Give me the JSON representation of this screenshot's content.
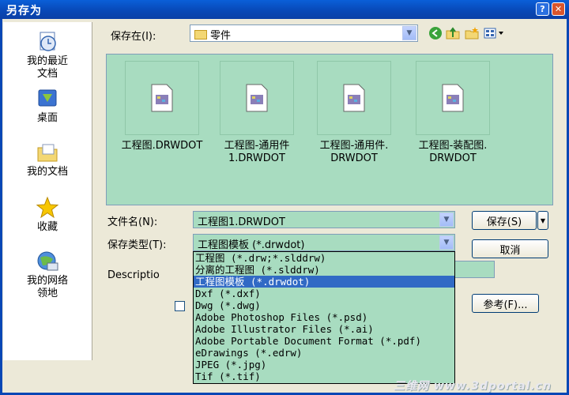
{
  "window": {
    "title": "另存为"
  },
  "places": [
    {
      "label": "我的最近\n文档",
      "icon": "recent-documents-icon"
    },
    {
      "label": "桌面",
      "icon": "desktop-icon"
    },
    {
      "label": "我的文档",
      "icon": "my-documents-icon"
    },
    {
      "label": "收藏",
      "icon": "favorites-icon"
    },
    {
      "label": "我的网络\n领地",
      "icon": "network-places-icon"
    }
  ],
  "save_in": {
    "label": "保存在(I):",
    "value": "零件"
  },
  "files": [
    {
      "name": "工程图.DRWDOT"
    },
    {
      "name": "工程图-通用件\n1.DRWDOT"
    },
    {
      "name": "工程图-通用件.\nDRWDOT"
    },
    {
      "name": "工程图-装配图.\nDRWDOT"
    }
  ],
  "filename": {
    "label": "文件名(N):",
    "value": "工程图1.DRWDOT"
  },
  "filetype": {
    "label": "保存类型(T):",
    "value": "工程图模板 (*.drwdot)"
  },
  "description": {
    "label": "Descriptio"
  },
  "buttons": {
    "save": "保存(S)",
    "cancel": "取消",
    "references": "参考(F)..."
  },
  "filetype_options": [
    "工程图 (*.drw;*.slddrw)",
    "分离的工程图 (*.slddrw)",
    "工程图模板 (*.drwdot)",
    "Dxf (*.dxf)",
    "Dwg (*.dwg)",
    "Adobe Photoshop Files (*.psd)",
    "Adobe Illustrator Files (*.ai)",
    "Adobe Portable Document Format (*.pdf)",
    "eDrawings (*.edrw)",
    "JPEG (*.jpg)",
    "Tif (*.tif)"
  ],
  "selected_option_index": 2,
  "watermark": "三维网 www.3dportal.cn"
}
